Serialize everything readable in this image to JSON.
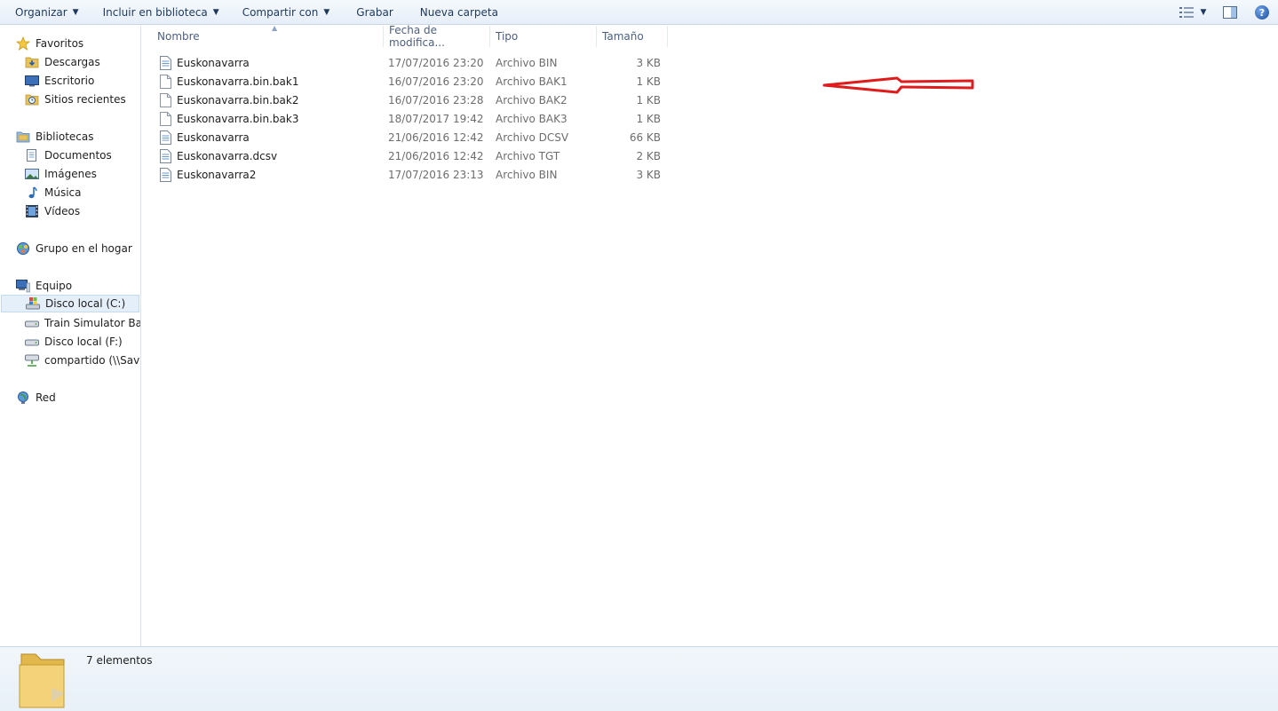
{
  "toolbar": {
    "organize": "Organizar",
    "include_library": "Incluir en biblioteca",
    "share_with": "Compartir con",
    "burn": "Grabar",
    "new_folder": "Nueva carpeta"
  },
  "sidebar": {
    "favorites": "Favoritos",
    "downloads": "Descargas",
    "desktop": "Escritorio",
    "recent": "Sitios recientes",
    "libraries": "Bibliotecas",
    "documents": "Documentos",
    "images": "Imágenes",
    "music": "Música",
    "videos": "Vídeos",
    "homegroup": "Grupo en el hogar",
    "computer": "Equipo",
    "drive_c": "Disco local (C:)",
    "drive_train": "Train Simulator Back",
    "drive_f": "Disco local (F:)",
    "network_share": "compartido (\\\\Savis-",
    "network": "Red"
  },
  "columns": {
    "name": "Nombre",
    "date": "Fecha de modifica...",
    "type": "Tipo",
    "size": "Tamaño"
  },
  "files": [
    {
      "name": "Euskonavarra",
      "date": "17/07/2016 23:20",
      "type": "Archivo BIN",
      "size": "3 KB",
      "icon": "doc-lines-icon"
    },
    {
      "name": "Euskonavarra.bin.bak1",
      "date": "16/07/2016 23:20",
      "type": "Archivo BAK1",
      "size": "1 KB",
      "icon": "blank-file-icon"
    },
    {
      "name": "Euskonavarra.bin.bak2",
      "date": "16/07/2016 23:28",
      "type": "Archivo BAK2",
      "size": "1 KB",
      "icon": "blank-file-icon"
    },
    {
      "name": "Euskonavarra.bin.bak3",
      "date": "18/07/2017 19:42",
      "type": "Archivo BAK3",
      "size": "1 KB",
      "icon": "blank-file-icon"
    },
    {
      "name": "Euskonavarra",
      "date": "21/06/2016 12:42",
      "type": "Archivo DCSV",
      "size": "66 KB",
      "icon": "doc-lines-icon"
    },
    {
      "name": "Euskonavarra.dcsv",
      "date": "21/06/2016 12:42",
      "type": "Archivo TGT",
      "size": "2 KB",
      "icon": "doc-lines-icon"
    },
    {
      "name": "Euskonavarra2",
      "date": "17/07/2016 23:13",
      "type": "Archivo BIN",
      "size": "3 KB",
      "icon": "doc-lines-icon"
    }
  ],
  "status": {
    "count": "7 elementos"
  },
  "colors": {
    "annotation_arrow": "#e01b1b",
    "selected_bg": "#e5eff9"
  }
}
